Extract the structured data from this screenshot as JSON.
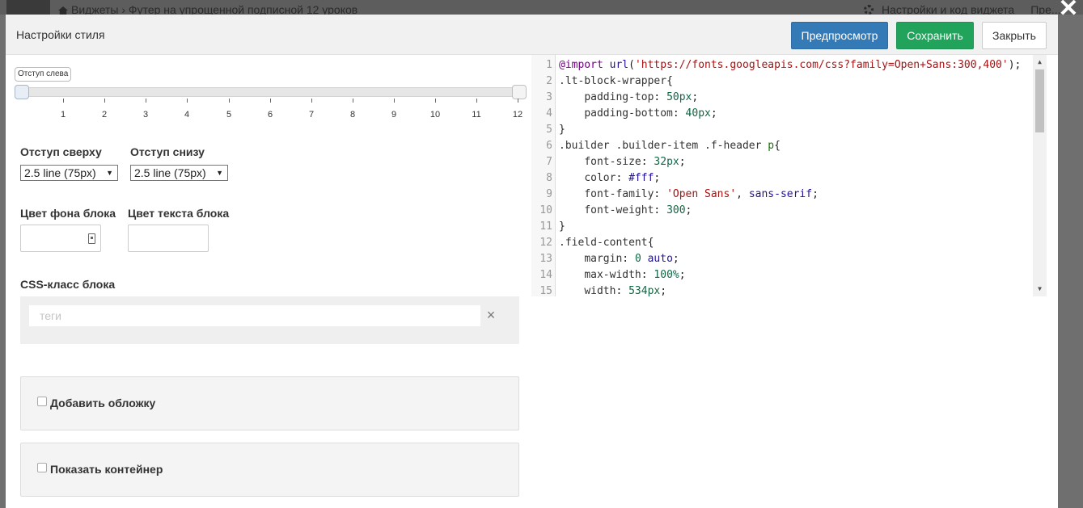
{
  "background": {
    "breadcrumb": "Виджеты  ›  Футер на упрощенной подписной 12 уроков",
    "settings_link": "Настройки и код виджета",
    "preview_link": "Пре..."
  },
  "close_overlay": "✕",
  "modal": {
    "title": "Настройки стиля",
    "buttons": {
      "preview": "Предпросмотр",
      "save": "Сохранить",
      "close": "Закрыть"
    }
  },
  "slider": {
    "tooltip": "Отступ слева",
    "value": 0,
    "max_value": 12,
    "ticks": [
      "1",
      "2",
      "3",
      "4",
      "5",
      "6",
      "7",
      "8",
      "9",
      "10",
      "11",
      "12"
    ]
  },
  "padding": {
    "top_label": "Отступ сверху",
    "top_value": "2.5 line (75px)",
    "bottom_label": "Отступ снизу",
    "bottom_value": "2.5 line (75px)"
  },
  "colors": {
    "bg_label": "Цвет фона блока",
    "text_label": "Цвет текста блока"
  },
  "css_class": {
    "label": "CSS-класс блока",
    "placeholder": "теги",
    "clear": "×"
  },
  "options": {
    "add_cover": "Добавить обложку",
    "show_container": "Показать контейнер"
  },
  "editor": {
    "line_numbers": [
      "1",
      "2",
      "3",
      "4",
      "5",
      "6",
      "7",
      "8",
      "9",
      "10",
      "11",
      "12",
      "13",
      "14",
      "15"
    ]
  }
}
